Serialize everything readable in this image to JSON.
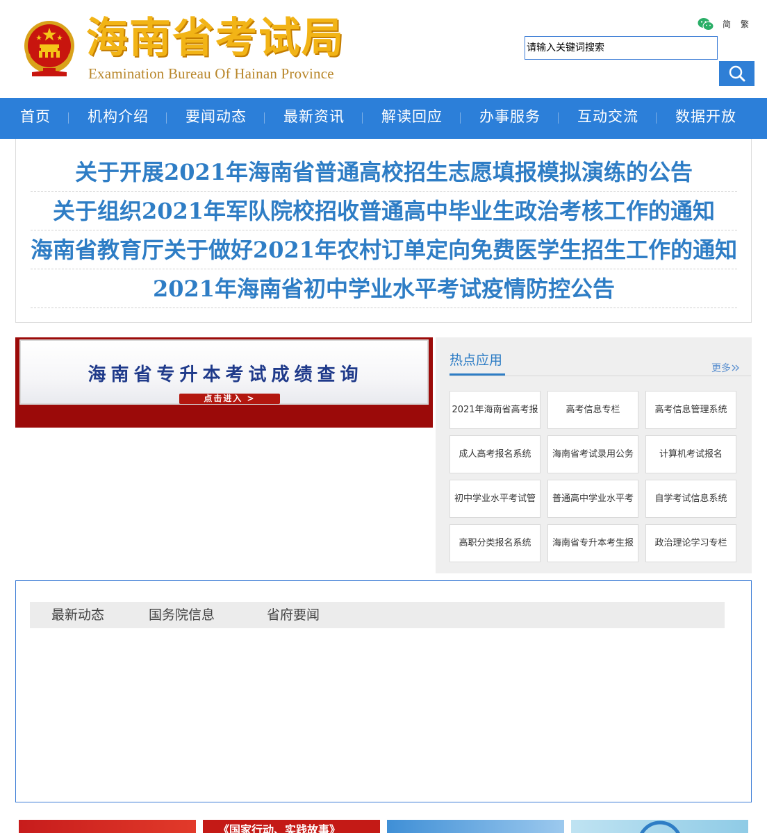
{
  "header": {
    "title": "海南省考试局",
    "subtitle": "Examination Bureau Of Hainan Province",
    "lang_simplified": "简",
    "lang_traditional": "繁",
    "search": {
      "value": "",
      "placeholder": "请输入关键词搜索"
    },
    "icons": {
      "emblem": "national-emblem-icon",
      "wechat": "wechat-icon",
      "search": "search-icon"
    },
    "colors": {
      "title": "#f2b416",
      "subtitle": "#b8862a",
      "search_button": "#2f7fd6"
    }
  },
  "nav": {
    "background": "#2c7fd9",
    "items": [
      {
        "label": "首页"
      },
      {
        "label": "机构介绍"
      },
      {
        "label": "要闻动态"
      },
      {
        "label": "最新资讯"
      },
      {
        "label": "解读回应"
      },
      {
        "label": "办事服务"
      },
      {
        "label": "互动交流"
      },
      {
        "label": "数据开放"
      }
    ]
  },
  "headlines": [
    "关于开展2021年海南省普通高校招生志愿填报模拟演练的公告",
    "关于组织2021年军队院校招收普通高中毕业生政治考核工作的通知",
    "海南省教育厅关于做好2021年农村订单定向免费医学生招生工作的通知",
    "2021年海南省初中学业水平考试疫情防控公告"
  ],
  "banner": {
    "title": "海南省专升本考试成绩查询",
    "cta": "点击进入 >"
  },
  "hot_apps": {
    "title": "热点应用",
    "more": "更多",
    "more_icon": "double-chevron-right-icon",
    "items": [
      "2021年海南省高考报",
      "高考信息专栏",
      "高考信息管理系统",
      "成人高考报名系统",
      "海南省考试录用公务",
      "计算机考试报名",
      "初中学业水平考试管",
      "普通高中学业水平考",
      "自学考试信息系统",
      "高职分类报名系统",
      "海南省专升本考生报",
      "政治理论学习专栏"
    ]
  },
  "news_tabs": {
    "tabs": [
      "最新动态",
      "国务院信息",
      "省府要闻"
    ]
  },
  "bottom_thumbs": {
    "caption_2": "《国家行动、实践故事》"
  }
}
